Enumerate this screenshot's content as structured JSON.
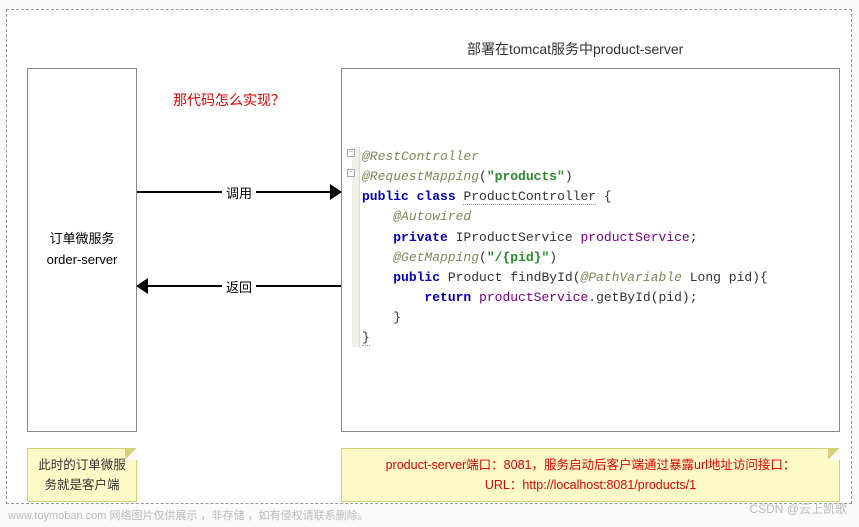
{
  "left_box": {
    "line1": "订单微服务",
    "line2": "order-server"
  },
  "right_title": "部署在tomcat服务中product-server",
  "red_question": "那代码怎么实现？",
  "arrows": {
    "call": "调用",
    "return": "返回"
  },
  "code": {
    "l1_anno": "@RestController",
    "l2_anno": "@RequestMapping",
    "l2_paren_open": "(",
    "l2_str": "\"products\"",
    "l2_paren_close": ")",
    "l3_kw1": "public",
    "l3_kw2": "class",
    "l3_cls": "ProductController",
    "l3_brace": " {",
    "l4_anno": "@Autowired",
    "l5_kw": "private",
    "l5_type": "IProductService",
    "l5_var": "productService",
    "l5_semi": ";",
    "l6_anno": "@GetMapping",
    "l6_paren_open": "(",
    "l6_str": "\"/{pid}\"",
    "l6_paren_close": ")",
    "l7_kw": "public",
    "l7_ret": "Product",
    "l7_meth": "findById",
    "l7_open": "(",
    "l7_pv": "@PathVariable",
    "l7_pt": "Long",
    "l7_pn": "pid",
    "l7_close": "){",
    "l8_kw": "return",
    "l8_var": "productService",
    "l8_dot": ".",
    "l8_call": "getById",
    "l8_args": "(pid);",
    "l9": "    }",
    "l10": "}"
  },
  "notes": {
    "left_l1": "此时的订单微服",
    "left_l2": "务就是客户端",
    "right_l1": "product-server端口：8081，服务启动后客户端通过暴露url地址访问接口：",
    "right_l2": "URL：http://localhost:8081/products/1"
  },
  "watermarks": {
    "left": "www.toymoban.com 网络图片仅供展示 ，非存储 ，如有侵权请联系删除。",
    "right": "CSDN @云上凯歌"
  }
}
